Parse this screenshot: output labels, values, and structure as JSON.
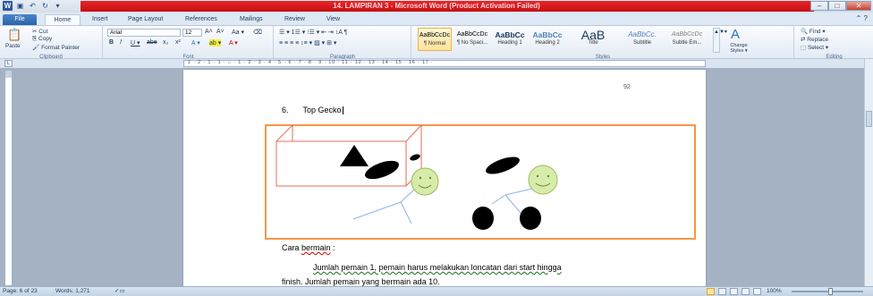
{
  "window": {
    "title": "14. LAMPIRAN 3 - Microsoft Word (Product Activation Failed)",
    "qat_icons": [
      "word-logo",
      "save-icon",
      "undo-icon",
      "redo-icon",
      "customize-icon"
    ],
    "buttons": {
      "minimize": "–",
      "maximize": "□",
      "close": "✕"
    }
  },
  "tabs": [
    "File",
    "Home",
    "Insert",
    "Page Layout",
    "References",
    "Mailings",
    "Review",
    "View"
  ],
  "active_tab": "Home",
  "ribbon": {
    "clipboard": {
      "paste": "Paste",
      "cut": "Cut",
      "copy": "Copy",
      "format_painter": "Format Painter",
      "label": "Clipboard"
    },
    "font": {
      "font_name": "Arial",
      "font_size": "12",
      "grow": "A˄",
      "shrink": "A˅",
      "case": "Aa ▾",
      "clear": "⌫",
      "bold": "B",
      "italic": "I",
      "underline": "U ▾",
      "strike": "abe",
      "subscript": "x₂",
      "superscript": "x²",
      "effects": "A ▾",
      "highlight": "ab ▾",
      "color": "A ▾",
      "label": "Font"
    },
    "paragraph": {
      "row1": "☰ ▾  1☰ ▾  ⁝☰ ▾   ⇤  ⇥   ↕A  ¶",
      "row2": "≡  ≡  ≡  ≡   ↕≡ ▾   ▨ ▾  ⊞ ▾",
      "label": "Paragraph"
    },
    "styles": {
      "items": [
        {
          "sample": "AaBbCcDc",
          "name": "¶ Normal"
        },
        {
          "sample": "AaBbCcDc",
          "name": "¶ No Spaci..."
        },
        {
          "sample": "AaBbCc",
          "name": "Heading 1"
        },
        {
          "sample": "AaBbCc",
          "name": "Heading 2"
        },
        {
          "sample": "AaB",
          "name": "Title"
        },
        {
          "sample": "AaBbCc.",
          "name": "Subtitle"
        },
        {
          "sample": "AaBbCcDc",
          "name": "Subtle Em..."
        }
      ],
      "change_styles": "Change Styles ▾",
      "label": "Styles"
    },
    "editing": {
      "find": "Find ▾",
      "replace": "Replace",
      "select": "Select ▾",
      "label": "Editing"
    }
  },
  "ruler": {
    "numbers": "· 1 · 2 · 1 · 1 · ⌂ · 1 · 2 · 3 · 4 · 5 · 6 · 7 · 8 · 9 · 10 · 11 · 12 · 13 · 14 · 15 · 16 · 17 ·",
    "corner": "L"
  },
  "document": {
    "page_number": "92",
    "heading_number": "6.",
    "heading_text": "Top Gecko",
    "cara_prefix": "Cara ",
    "cara_word": "bermain",
    "cara_suffix": " :",
    "para_line1": "Jumlah pemain 1, pemain harus melakukan loncatan dari start hingga",
    "para_line2": "finish. Jumlah pemain yang bermain ada 10."
  },
  "status": {
    "page": "Page: 6 of 23",
    "words": "Words: 1,271",
    "zoom": "100%"
  }
}
